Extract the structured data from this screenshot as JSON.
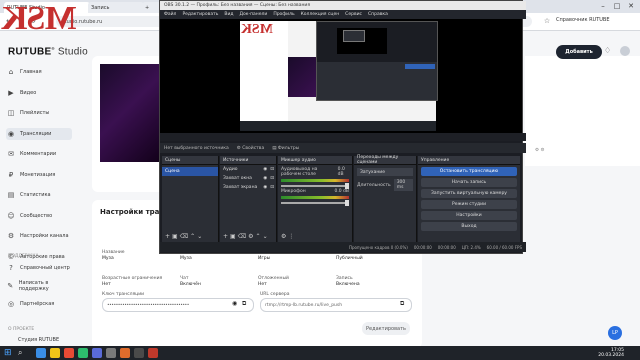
{
  "watermark": {
    "text": "MSK"
  },
  "browser": {
    "tabs": [
      {
        "label": "RUTUBE Studio"
      },
      {
        "label": "Запись"
      },
      {
        "label": ""
      }
    ],
    "new_tab": "+",
    "url": "studio.rutube.ru",
    "right_link": "Справочник RUTUBE",
    "window_controls": [
      "–",
      "□",
      "✕"
    ]
  },
  "rutube": {
    "logo_brand": "RUTUBE",
    "logo_sub": "Studio",
    "publish_label": "Добавить",
    "sidebar": [
      {
        "icon": "home-icon",
        "glyph": "⌂",
        "label": "Главная"
      },
      {
        "icon": "video-icon",
        "glyph": "▶",
        "label": "Видео"
      },
      {
        "icon": "shorts-icon",
        "glyph": "◫",
        "label": "Плейлисты"
      },
      {
        "icon": "live-icon",
        "glyph": "◉",
        "label": "Трансляции"
      },
      {
        "icon": "chat-icon",
        "glyph": "✉",
        "label": "Комментарии"
      },
      {
        "icon": "money-icon",
        "glyph": "₽",
        "label": "Монетизация"
      },
      {
        "icon": "chart-icon",
        "glyph": "▤",
        "label": "Статистика"
      },
      {
        "icon": "audience-icon",
        "glyph": "☺",
        "label": "Сообщество"
      },
      {
        "icon": "settings-icon",
        "glyph": "⚙",
        "label": "Настройки канала"
      },
      {
        "icon": "copyright-icon",
        "glyph": "©",
        "label": "Авторские права"
      }
    ],
    "section_header": "ПОДДЕРЖКА",
    "support_items": [
      {
        "icon": "help-icon",
        "glyph": "?",
        "label": "Справочный центр"
      },
      {
        "icon": "feedback-icon",
        "glyph": "✎",
        "label": "Написать в поддержку"
      },
      {
        "icon": "partners-icon",
        "glyph": "◎",
        "label": "Партнёрская"
      }
    ],
    "footer_header": "О ПРОЕКТЕ",
    "footer_item": "Студия RUTUBE",
    "settings_title": "Настройки трансляции",
    "fields": [
      {
        "label": "Название",
        "value": "Муза"
      },
      {
        "label": "Описание",
        "value": "Муза"
      },
      {
        "label": "Категория",
        "value": "Игры"
      },
      {
        "label": "Доступ",
        "value": "Публичный"
      },
      {
        "label": "Возрастные ограничения",
        "value": "Нет"
      },
      {
        "label": "Чат",
        "value": "Включён"
      },
      {
        "label": "Отложенный",
        "value": "Нет"
      },
      {
        "label": "Запись",
        "value": "Включена"
      }
    ],
    "stream_key_label": "Ключ трансляции",
    "stream_key_value": "••••••••••••••••••••••••••••••••••••••",
    "server_label": "URL сервера",
    "server_value": "rtmp://rtmp-lb.rutube.ru/live_push",
    "save_label": "Редактировать",
    "help_badge": "LP"
  },
  "obs": {
    "title": "OBS 30.1.2 — Профиль: Без названия — Сцены: Без названия",
    "menu": [
      "Файл",
      "Редактировать",
      "Вид",
      "Док-панели",
      "Профиль",
      "Коллекция сцен",
      "Сервис",
      "Справка"
    ],
    "source_bar": [
      "Нет выбранного источника",
      "Свойства",
      "Фильтры"
    ],
    "docks": {
      "scenes": {
        "title": "Сцены",
        "items": [
          "Сцена"
        ]
      },
      "sources": {
        "title": "Источники",
        "items": [
          "Аудио",
          "Захват окна",
          "Захват экрана"
        ]
      },
      "mixer": {
        "title": "Микшер аудио",
        "tracks": [
          {
            "name": "Аудиовыход на рабочем столе",
            "db": "0.0 dB"
          },
          {
            "name": "Микрофон",
            "db": "0.0 dB"
          }
        ]
      },
      "transitions": {
        "title": "Переходы между сценами",
        "type": "Затухание",
        "duration_label": "Длительность",
        "duration": "300 ms"
      },
      "controls": {
        "title": "Управление",
        "buttons": [
          {
            "label": "Остановить трансляцию",
            "primary": true
          },
          {
            "label": "Начать запись",
            "primary": false
          },
          {
            "label": "Запустить виртуальную камеру",
            "primary": false
          },
          {
            "label": "Режим студии",
            "primary": false
          },
          {
            "label": "Настройки",
            "primary": false
          },
          {
            "label": "Выход",
            "primary": false
          }
        ]
      }
    },
    "status": [
      "Пропущено кадров 0 (0.0%)",
      "00:00:00",
      "00:00:00",
      "ЦП: 2.4%",
      "60.00 / 60.00 FPS"
    ]
  },
  "taskbar": {
    "time": "17:05",
    "date": "20.03.2024"
  },
  "colors": {
    "accent": "#3063b8",
    "watermark": "#c5302f",
    "obs_bg": "#1b1d23"
  }
}
